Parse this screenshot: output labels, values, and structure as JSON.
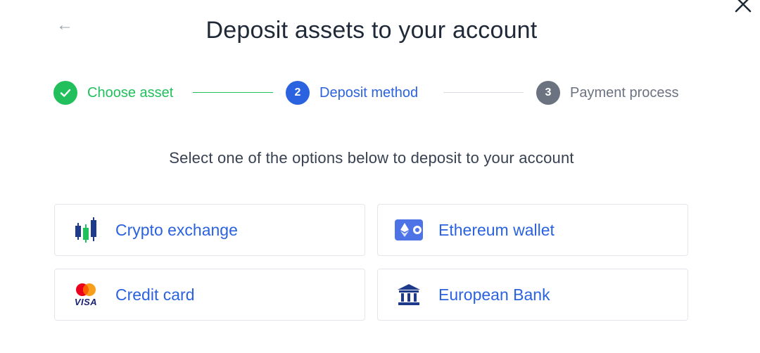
{
  "header": {
    "back_label": "←",
    "title": "Deposit assets to your account"
  },
  "stepper": {
    "steps": [
      {
        "number": "1",
        "label": "Choose asset",
        "state": "completed",
        "color": "#21c05c"
      },
      {
        "number": "2",
        "label": "Deposit method",
        "state": "active",
        "color": "#2b62e0"
      },
      {
        "number": "3",
        "label": "Payment process",
        "state": "pending",
        "color": "#6b7280"
      }
    ]
  },
  "subtitle": "Select one of the options below to deposit to your account",
  "options": [
    {
      "label": "Crypto exchange",
      "icon": "candlestick-chart-icon"
    },
    {
      "label": "Ethereum wallet",
      "icon": "ethereum-wallet-icon"
    },
    {
      "label": "Credit card",
      "icon": "mastercard-visa-icon",
      "card_text": "VISA"
    },
    {
      "label": "European Bank",
      "icon": "bank-building-icon"
    }
  ],
  "colors": {
    "accent": "#2b62e0",
    "success": "#21c05c",
    "muted": "#6b7280"
  }
}
